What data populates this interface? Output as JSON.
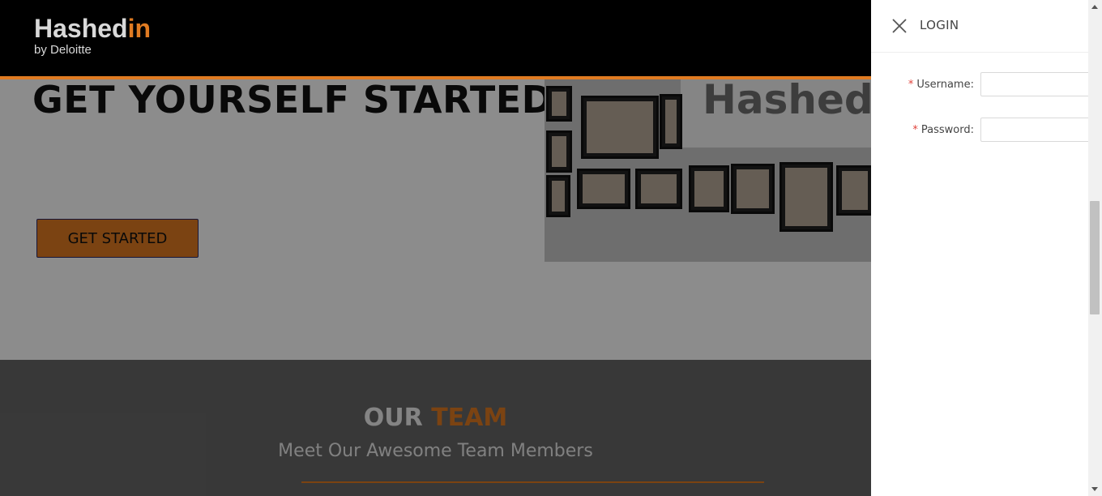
{
  "header": {
    "brand_main": "Hashed",
    "brand_accent": "in",
    "brand_tagline": "by Deloitte"
  },
  "hero": {
    "title": "GET YOURSELF STARTED ...",
    "cta_label": "GET STARTED",
    "photo_wall_text": "Hashed"
  },
  "team": {
    "heading_part1": "OUR",
    "heading_part2": "TEAM",
    "subtitle": "Meet Our Awesome Team Members"
  },
  "login_drawer": {
    "title": "LOGIN",
    "close_icon": "close-icon",
    "fields": [
      {
        "label": "Username",
        "required_mark": "*",
        "separator": ":",
        "value": ""
      },
      {
        "label": "Password",
        "required_mark": "*",
        "separator": ":",
        "value": ""
      }
    ]
  },
  "colors": {
    "accent": "#e07b22",
    "header_bg": "#000000",
    "required": "#e0433b"
  }
}
